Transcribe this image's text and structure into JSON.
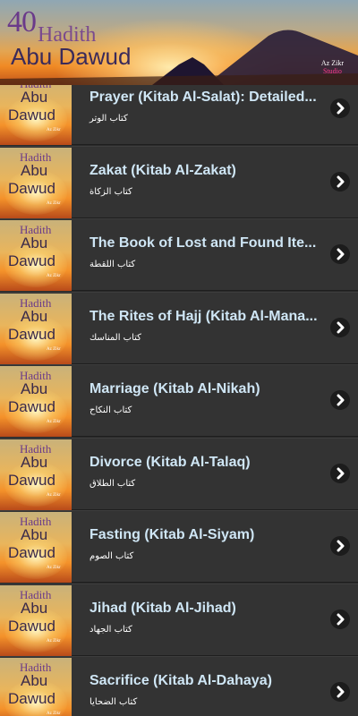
{
  "banner": {
    "number": "40",
    "word": "Hadith",
    "subtitle": "Abu Dawud",
    "brand_line1": "Az Zikr",
    "brand_line2": "Studio"
  },
  "thumb": {
    "line1": "Hadith",
    "line2": "Abu",
    "line3": "Dawud",
    "brand": "Az Zikr"
  },
  "items": [
    {
      "title": "Prayer (Kitab Al-Salat): Detailed...",
      "subtitle": "كتاب الوتر"
    },
    {
      "title": "Zakat (Kitab Al-Zakat)",
      "subtitle": "كتاب الزكاة"
    },
    {
      "title": "The Book of Lost and Found Ite...",
      "subtitle": "كتاب اللقطة"
    },
    {
      "title": "The Rites of Hajj (Kitab Al-Mana...",
      "subtitle": "كتاب المناسك"
    },
    {
      "title": "Marriage (Kitab Al-Nikah)",
      "subtitle": "كتاب النكاح"
    },
    {
      "title": "Divorce (Kitab Al-Talaq)",
      "subtitle": "كتاب الطلاق"
    },
    {
      "title": "Fasting (Kitab Al-Siyam)",
      "subtitle": "كتاب الصوم"
    },
    {
      "title": "Jihad (Kitab Al-Jihad)",
      "subtitle": "كتاب الجهاد"
    },
    {
      "title": "Sacrifice (Kitab Al-Dahaya)",
      "subtitle": "كتاب الضحايا"
    }
  ],
  "icons": {
    "row_arrow": "chevron-right-icon"
  },
  "colors": {
    "row_bg": "#333333",
    "title": "#cfe6f5",
    "arrow_bg": "#1c1c1c"
  }
}
